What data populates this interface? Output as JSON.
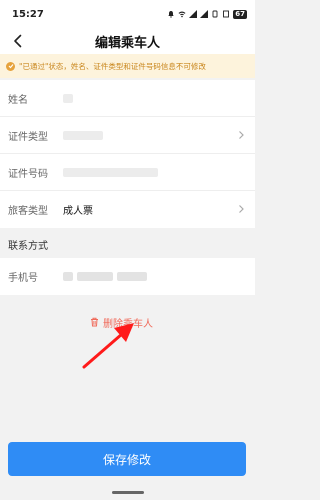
{
  "status_bar": {
    "time": "15:27",
    "battery": "67"
  },
  "header": {
    "title": "编辑乘车人"
  },
  "notice": {
    "text": "\"已通过\"状态，姓名、证件类型和证件号码信息不可修改"
  },
  "form": {
    "rows": [
      {
        "label": "姓名",
        "value": ""
      },
      {
        "label": "证件类型",
        "value": ""
      },
      {
        "label": "证件号码",
        "value": ""
      },
      {
        "label": "旅客类型",
        "value": "成人票"
      }
    ]
  },
  "contact": {
    "section_title": "联系方式",
    "phone_label": "手机号",
    "phone_value": ""
  },
  "actions": {
    "delete_label": "删除乘车人",
    "save_label": "保存修改"
  },
  "colors": {
    "accent": "#2f8cf5",
    "danger": "#f06a5a",
    "notice_bg": "#fdf3dc",
    "notice_text": "#c9861c"
  },
  "icons": {
    "back": "chevron-left-icon",
    "notice": "check-circle-icon",
    "delete": "trash-icon",
    "annotation": "red-arrow-icon"
  }
}
